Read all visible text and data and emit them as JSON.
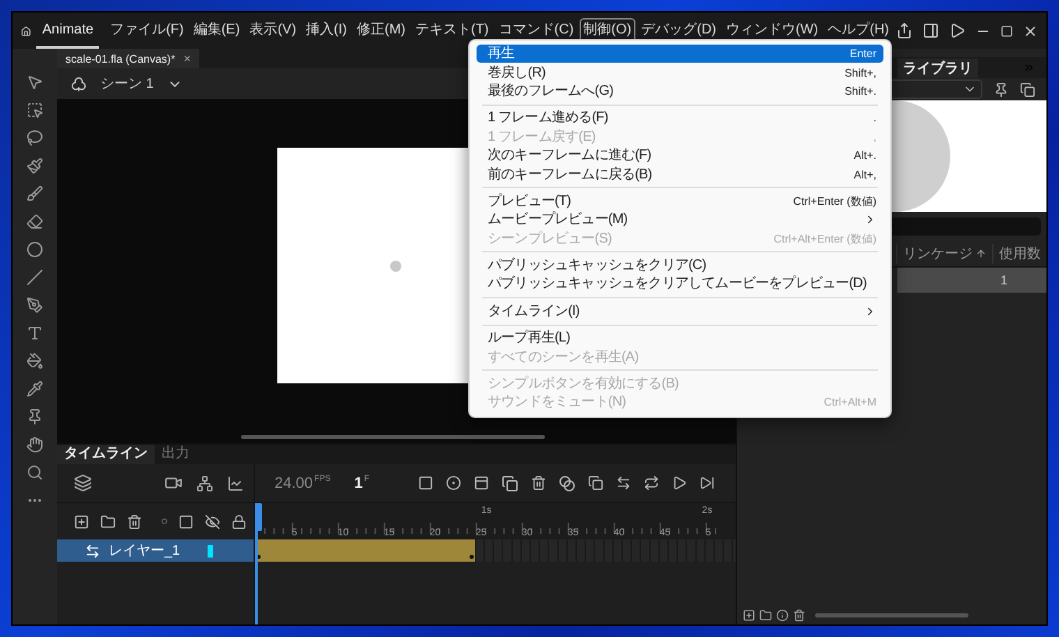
{
  "app": {
    "name": "Animate"
  },
  "menubar": [
    {
      "label": "ファイル(F)",
      "selected": false
    },
    {
      "label": "編集(E)",
      "selected": false
    },
    {
      "label": "表示(V)",
      "selected": false
    },
    {
      "label": "挿入(I)",
      "selected": false
    },
    {
      "label": "修正(M)",
      "selected": false
    },
    {
      "label": "テキスト(T)",
      "selected": false
    },
    {
      "label": "コマンド(C)",
      "selected": false
    },
    {
      "label": "制御(O)",
      "selected": true
    },
    {
      "label": "デバッグ(D)",
      "selected": false
    },
    {
      "label": "ウィンドウ(W)",
      "selected": false
    },
    {
      "label": "ヘルプ(H)",
      "selected": false
    }
  ],
  "document_tab": {
    "title": "scale-01.fla (Canvas)*",
    "close": "×"
  },
  "scene": {
    "label": "シーン 1"
  },
  "timeline": {
    "tabs": [
      {
        "label": "タイムライン",
        "selected": true
      },
      {
        "label": "出力",
        "selected": false
      }
    ],
    "fps": "24.00",
    "fps_unit": "FPS",
    "frame": "1",
    "frame_unit": "F",
    "seconds": [
      "1s",
      "2s"
    ],
    "frame_numbers": [
      "5",
      "10",
      "15",
      "20",
      "25",
      "30",
      "35",
      "40",
      "45",
      "5"
    ],
    "layers": [
      {
        "name": "レイヤー_1",
        "selected": true,
        "color": "#00e5ff"
      }
    ]
  },
  "library": {
    "tab": "ライブラリ",
    "columns": [
      "リンケージ",
      "使用数"
    ],
    "rows": [
      {
        "count": "1",
        "selected": true
      }
    ]
  },
  "menu": {
    "items": [
      {
        "kind": "item",
        "label": "再生",
        "shortcut": "Enter",
        "disabled": false,
        "selected": true,
        "submenu": false
      },
      {
        "kind": "item",
        "label": "巻戻し(R)",
        "shortcut": "Shift+,",
        "disabled": false,
        "selected": false,
        "submenu": false
      },
      {
        "kind": "item",
        "label": "最後のフレームへ(G)",
        "shortcut": "Shift+.",
        "disabled": false,
        "selected": false,
        "submenu": false
      },
      {
        "kind": "separator"
      },
      {
        "kind": "item",
        "label": "1 フレーム進める(F)",
        "shortcut": ".",
        "disabled": false,
        "selected": false,
        "submenu": false
      },
      {
        "kind": "item",
        "label": "1 フレーム戻す(E)",
        "shortcut": ",",
        "disabled": true,
        "selected": false,
        "submenu": false
      },
      {
        "kind": "item",
        "label": "次のキーフレームに進む(F)",
        "shortcut": "Alt+.",
        "disabled": false,
        "selected": false,
        "submenu": false
      },
      {
        "kind": "item",
        "label": "前のキーフレームに戻る(B)",
        "shortcut": "Alt+,",
        "disabled": false,
        "selected": false,
        "submenu": false
      },
      {
        "kind": "separator"
      },
      {
        "kind": "item",
        "label": "プレビュー(T)",
        "shortcut": "Ctrl+Enter (数値)",
        "disabled": false,
        "selected": false,
        "submenu": false
      },
      {
        "kind": "item",
        "label": "ムービープレビュー(M)",
        "disabled": false,
        "selected": false,
        "submenu": true
      },
      {
        "kind": "item",
        "label": "シーンプレビュー(S)",
        "shortcut": "Ctrl+Alt+Enter (数値)",
        "disabled": true,
        "selected": false,
        "submenu": false
      },
      {
        "kind": "separator"
      },
      {
        "kind": "item",
        "label": "パブリッシュキャッシュをクリア(C)",
        "disabled": false,
        "selected": false,
        "submenu": false
      },
      {
        "kind": "item",
        "label": "パブリッシュキャッシュをクリアしてムービーをプレビュー(D)",
        "disabled": false,
        "selected": false,
        "submenu": false
      },
      {
        "kind": "separator"
      },
      {
        "kind": "item",
        "label": "タイムライン(I)",
        "disabled": false,
        "selected": false,
        "submenu": true
      },
      {
        "kind": "separator"
      },
      {
        "kind": "item",
        "label": "ループ再生(L)",
        "disabled": false,
        "selected": false,
        "submenu": false
      },
      {
        "kind": "item",
        "label": "すべてのシーンを再生(A)",
        "disabled": true,
        "selected": false,
        "submenu": false
      },
      {
        "kind": "separator"
      },
      {
        "kind": "item",
        "label": "シンプルボタンを有効にする(B)",
        "disabled": true,
        "selected": false,
        "submenu": false
      },
      {
        "kind": "item",
        "label": "サウンドをミュート(N)",
        "shortcut": "Ctrl+Alt+M",
        "disabled": true,
        "selected": false,
        "submenu": false
      }
    ]
  }
}
